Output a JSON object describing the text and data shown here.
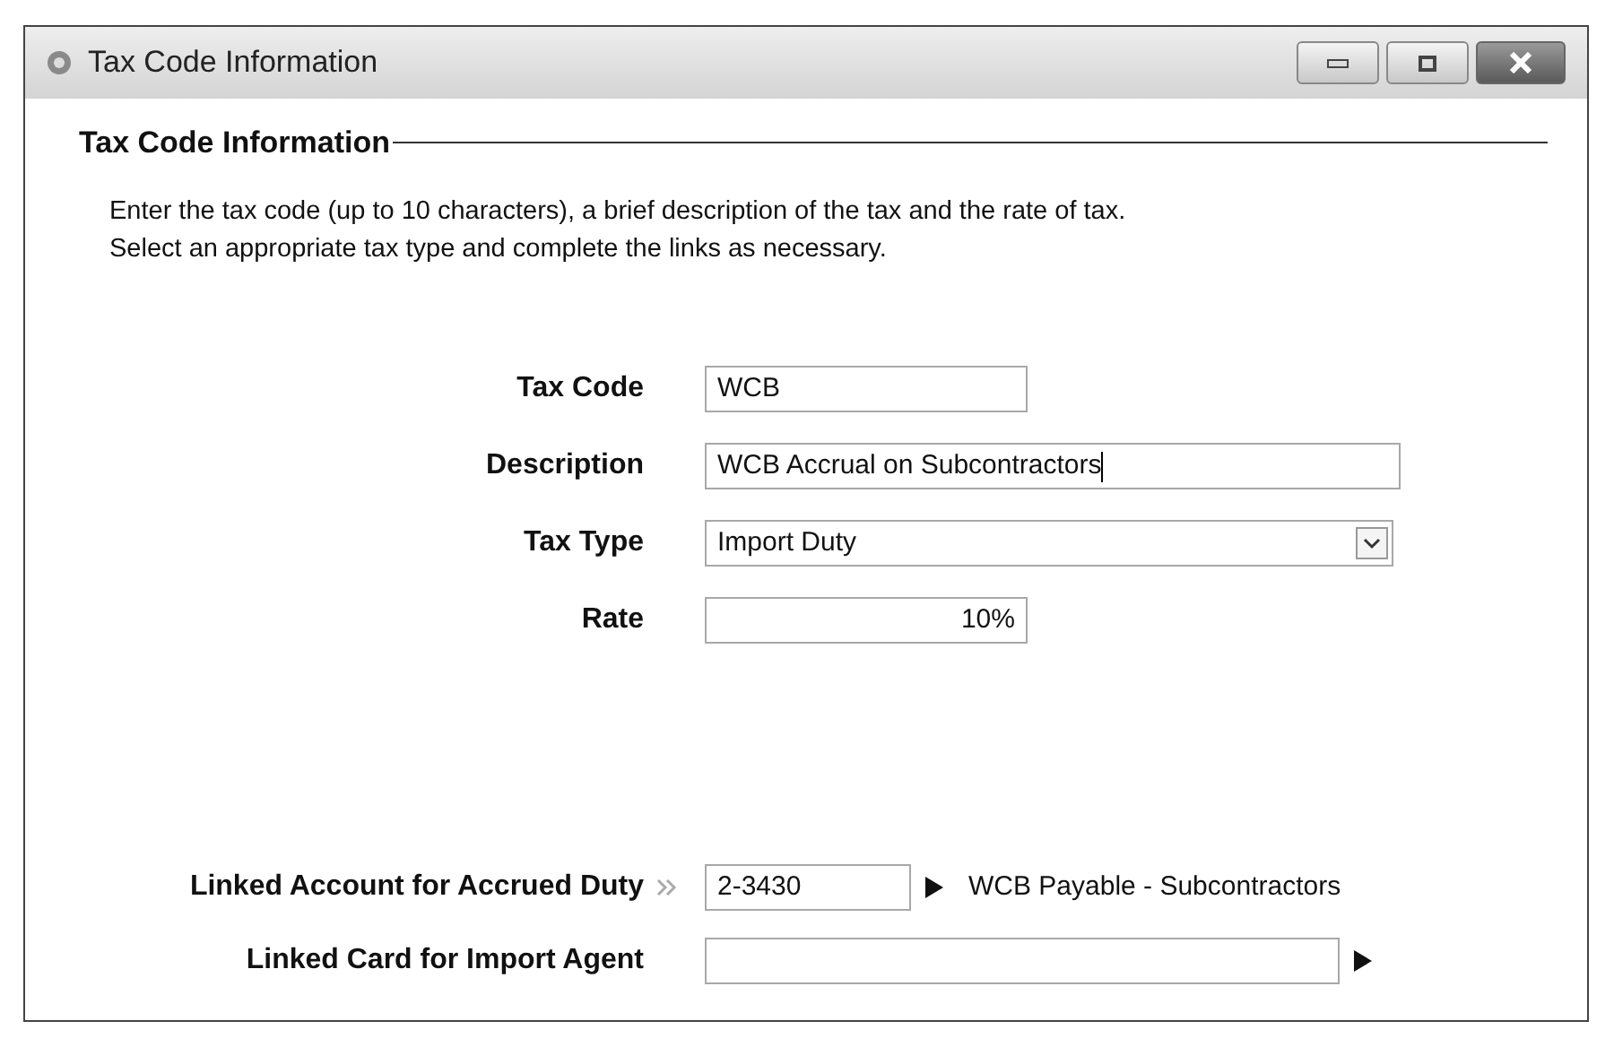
{
  "window": {
    "title": "Tax Code Information"
  },
  "section": {
    "title": "Tax Code Information",
    "instructions": [
      "Enter the tax code (up to 10 characters), a brief description of the tax and the rate of tax.",
      "Select an appropriate tax type and complete the links as necessary."
    ]
  },
  "fields": [
    {
      "kind": "code",
      "label": "Tax Code",
      "value": "WCB"
    },
    {
      "kind": "text",
      "label": "Description",
      "value": "WCB Accrual on Subcontractors",
      "focused": true
    },
    {
      "kind": "select",
      "label": "Tax Type",
      "value": "Import Duty"
    },
    {
      "kind": "number",
      "label": "Rate",
      "value": "10%"
    }
  ],
  "links": [
    {
      "label": "Linked Account for Accrued Duty",
      "value": "2-3430",
      "account_name": "WCB Payable - Subcontractors",
      "required": true
    },
    {
      "label": "Linked Card for Import Agent",
      "required": false
    }
  ]
}
